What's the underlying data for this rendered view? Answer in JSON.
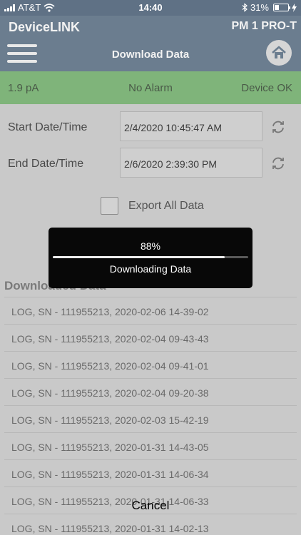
{
  "status_bar": {
    "carrier": "AT&T",
    "time": "14:40",
    "battery_percent": "31%",
    "battery_level": 31
  },
  "header": {
    "app_name": "DeviceLINK",
    "device_model": "PM 1 PRO-T",
    "title": "Download Data",
    "menu_icon": "hamburger-icon",
    "home_icon": "home-icon"
  },
  "device_status": {
    "reading": "1.9  pA",
    "alarm": "No Alarm",
    "device": "Device OK"
  },
  "form": {
    "start_label": "Start Date/Time",
    "start_value": "2/4/2020 10:45:47 AM",
    "end_label": "End Date/Time",
    "end_value": "2/6/2020 2:39:30 PM",
    "export_label": "Export All Data",
    "export_checked": false
  },
  "downloaded": {
    "title": "Downloaded Data",
    "logs": [
      "LOG, SN - 111955213, 2020-02-06 14-39-02",
      "LOG, SN - 111955213, 2020-02-04 09-43-43",
      "LOG, SN - 111955213, 2020-02-04 09-41-01",
      "LOG, SN - 111955213, 2020-02-04 09-20-38",
      "LOG, SN - 111955213, 2020-02-03 15-42-19",
      "LOG, SN - 111955213, 2020-01-31 14-43-05",
      "LOG, SN - 111955213, 2020-01-31 14-06-34",
      "LOG, SN - 111955213, 2020-01-31 14-06-33",
      "LOG, SN - 111955213, 2020-01-31 14-02-13"
    ]
  },
  "progress": {
    "percent_label": "88%",
    "fraction": 0.88,
    "message": "Downloading Data"
  },
  "cancel_label": "Cancel",
  "colors": {
    "header": "#6b7d8f",
    "status_ok": "#7fb47a",
    "hud_background": "#080808"
  }
}
